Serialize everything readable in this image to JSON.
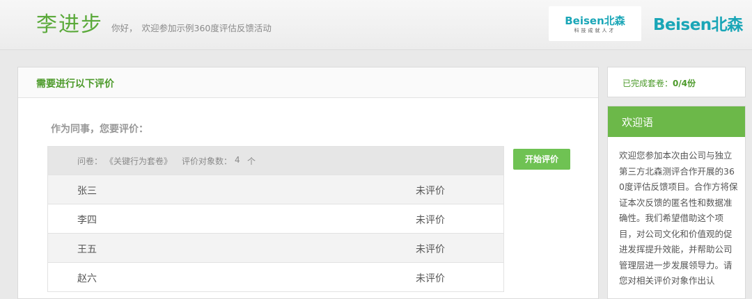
{
  "header": {
    "user_name": "李进步",
    "greeting_hello": "你好，",
    "greeting_message": "欢迎参加示例360度评估反馈活动",
    "logo_small_text": "Beisen北森",
    "logo_small_slogan": "科技成就人才",
    "logo_big_text": "Beisen北森"
  },
  "main": {
    "title": "需要进行以下评价",
    "section_title": "作为同事，您要评价：",
    "questionnaire_label": "问卷：",
    "questionnaire_name": "《关键行为套卷》",
    "target_count_label": "评价对象数：",
    "target_count": "4",
    "target_count_unit": "个",
    "start_button": "开始评价",
    "rows": [
      {
        "name": "张三",
        "status": "未评价"
      },
      {
        "name": "李四",
        "status": "未评价"
      },
      {
        "name": "王五",
        "status": "未评价"
      },
      {
        "name": "赵六",
        "status": "未评价"
      }
    ]
  },
  "sidebar": {
    "progress_label": "已完成套卷：",
    "progress_value": "0/4份",
    "welcome_title": "欢迎语",
    "welcome_text": "欢迎您参加本次由公司与独立第三方北森测评合作开展的360度评估反馈项目。合作方将保证本次反馈的匿名性和数据准确性。我们希望借助这个项目，对公司文化和价值观的促进发挥提升效能，并帮助公司管理层进一步发展领导力。请您对相关评价对象作出认"
  },
  "colors": {
    "brand_green": "#5aa93a",
    "button_green": "#6fc253",
    "panel_green": "#6cb849",
    "logo_teal": "#1aa6b7"
  }
}
